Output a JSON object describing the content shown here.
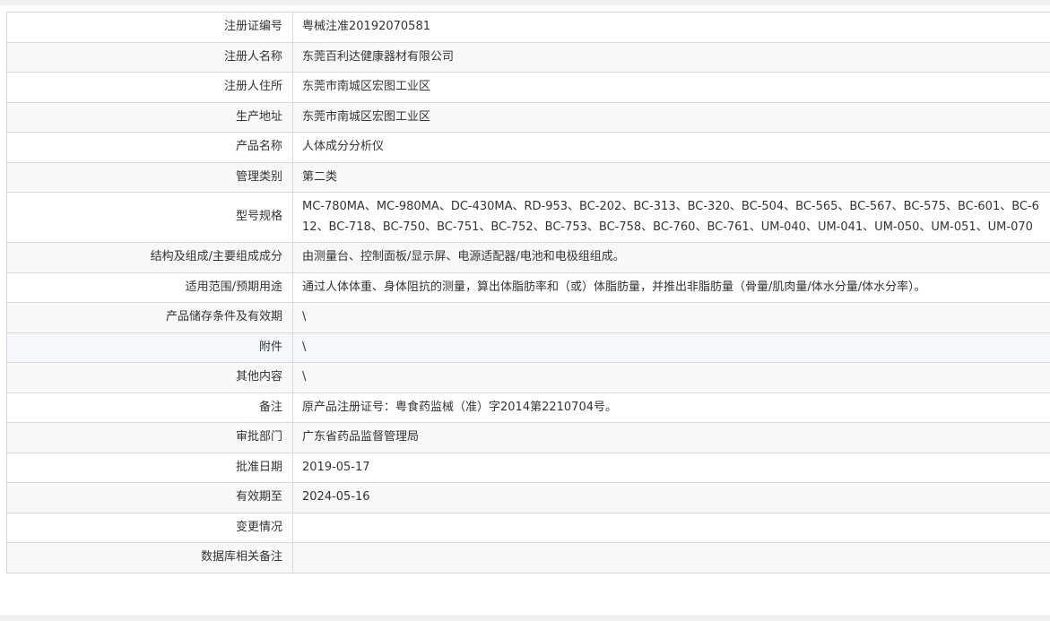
{
  "rows": [
    {
      "label": "注册证编号",
      "value": "粤械注准20192070581"
    },
    {
      "label": "注册人名称",
      "value": "东莞百利达健康器材有限公司"
    },
    {
      "label": "注册人住所",
      "value": "东莞市南城区宏图工业区"
    },
    {
      "label": "生产地址",
      "value": "东莞市南城区宏图工业区"
    },
    {
      "label": "产品名称",
      "value": "人体成分分析仪"
    },
    {
      "label": "管理类别",
      "value": "第二类"
    },
    {
      "label": "型号规格",
      "value": "MC-780MA、MC-980MA、DC-430MA、RD-953、BC-202、BC-313、BC-320、BC-504、BC-565、BC-567、BC-575、BC-601、BC-612、BC-718、BC-750、BC-751、BC-752、BC-753、BC-758、BC-760、BC-761、UM-040、UM-041、UM-050、UM-051、UM-070"
    },
    {
      "label": "结构及组成/主要组成成分",
      "value": "由测量台、控制面板/显示屏、电源适配器/电池和电极组组成。"
    },
    {
      "label": "适用范围/预期用途",
      "value": "通过人体体重、身体阻抗的测量，算出体脂肪率和（或）体脂肪量，并推出非脂肪量（骨量/肌肉量/体水分量/体水分率）。"
    },
    {
      "label": "产品储存条件及有效期",
      "value": "\\"
    },
    {
      "label": "附件",
      "value": "\\"
    },
    {
      "label": "其他内容",
      "value": "\\"
    },
    {
      "label": "备注",
      "value": "原产品注册证号：粤食药监械（准）字2014第2210704号。"
    },
    {
      "label": "审批部门",
      "value": "广东省药品监督管理局"
    },
    {
      "label": "批准日期",
      "value": "2019-05-17"
    },
    {
      "label": "有效期至",
      "value": "2024-05-16"
    },
    {
      "label": "变更情况",
      "value": ""
    },
    {
      "label": "数据库相关备注",
      "value": ""
    }
  ]
}
